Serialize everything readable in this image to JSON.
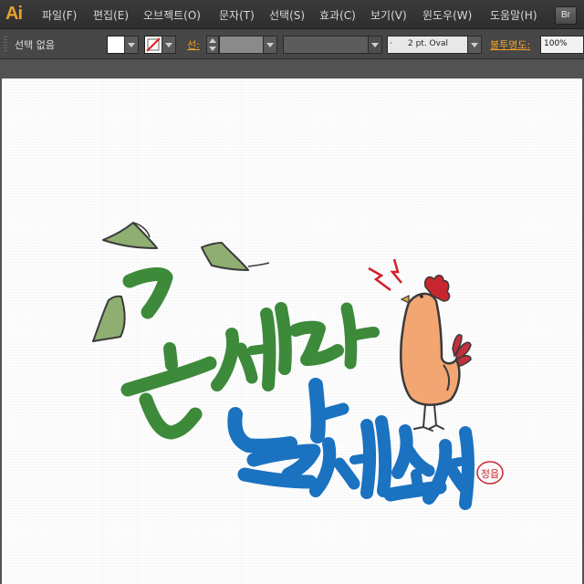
{
  "app": {
    "logo_text": "Ai",
    "bridge_label": "Br"
  },
  "menu": [
    {
      "label": "파일(F)"
    },
    {
      "label": "편집(E)"
    },
    {
      "label": "오브젝트(O)"
    },
    {
      "label": "문자(T)"
    },
    {
      "label": "선택(S)"
    },
    {
      "label": "효과(C)"
    },
    {
      "label": "보기(V)"
    },
    {
      "label": "윈도우(W)"
    },
    {
      "label": "도움말(H)"
    }
  ],
  "controlbar": {
    "selection_status": "선택 없음",
    "fill_color": "#ffffff",
    "stroke_color": "none",
    "stroke_label": "선:",
    "brush_value": "2 pt. Oval",
    "brush_bullet": "·",
    "opacity_label": "불투명도:",
    "opacity_value": "100%"
  },
  "artwork": {
    "title_line1": "돈세다",
    "title_line2": "날세소서",
    "seal_text": "정읍",
    "colors": {
      "green": "#3c8a3a",
      "blue": "#1a72c0",
      "money_green": "#8fae72",
      "rooster_body": "#f4a672",
      "comb_red": "#c8262e",
      "tail_red": "#c0303e",
      "spark_red": "#d21f2b",
      "outline": "#3a3a3a"
    },
    "icons": [
      "money-bill-icon",
      "rooster-icon",
      "alarm-spark-icon",
      "seal-stamp-icon"
    ]
  }
}
